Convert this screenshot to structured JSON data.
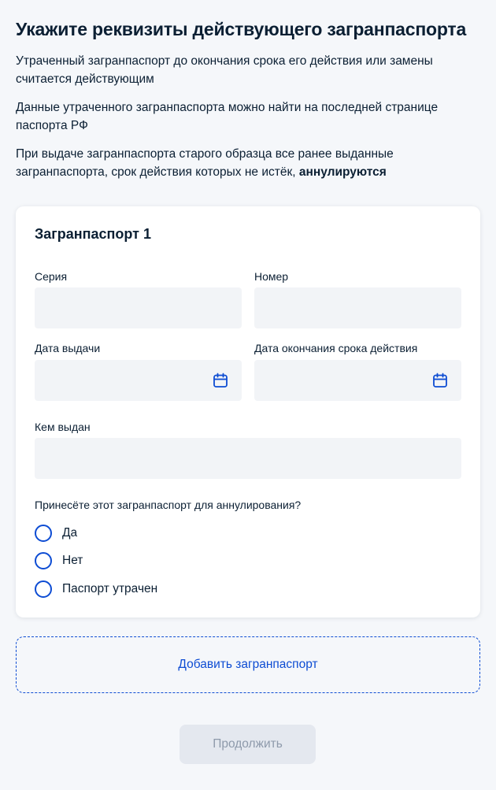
{
  "header": {
    "title": "Укажите реквизиты действующего загранпаспорта"
  },
  "info": {
    "p1": "Утраченный загранпаспорт до окончания срока его действия или замены считается действующим",
    "p2": "Данные утраченного загранпаспорта можно найти на последней странице паспорта РФ",
    "p3_text": "При выдаче загранпаспорта старого образца все ранее выданные загранпаспорта, срок действия которых не истёк, ",
    "p3_bold": "аннулируются"
  },
  "form": {
    "card_title": "Загранпаспорт 1",
    "series_label": "Серия",
    "series_value": "",
    "number_label": "Номер",
    "number_value": "",
    "issue_date_label": "Дата выдачи",
    "issue_date_value": "",
    "expiry_date_label": "Дата окончания срока действия",
    "expiry_date_value": "",
    "issued_by_label": "Кем выдан",
    "issued_by_value": "",
    "question": "Принесёте этот загранпаспорт для аннулирования?",
    "options": [
      "Да",
      "Нет",
      "Паспорт утрачен"
    ],
    "selected_option": null
  },
  "actions": {
    "add_label": "Добавить загранпаспорт",
    "continue_label": "Продолжить",
    "continue_enabled": false
  },
  "colors": {
    "accent": "#0d4cd3",
    "text": "#0b1f33",
    "input_bg": "#f2f4f7",
    "page_bg": "#f5f7fa",
    "disabled_bg": "#e4e8ef",
    "disabled_text": "#8e9aab"
  },
  "icons": {
    "date_picker": "calendar-icon",
    "radio": "radio-circle"
  }
}
